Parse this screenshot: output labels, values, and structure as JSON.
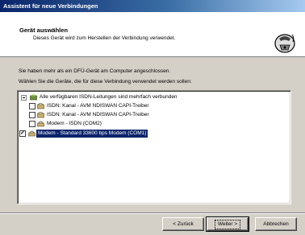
{
  "window": {
    "title": "Assistent für neue Verbindungen"
  },
  "header": {
    "title": "Gerät auswählen",
    "subtitle": "Dieses Gerät wird zum Herstellen der Verbindung verwendet.",
    "icon": "phone-connection-icon"
  },
  "instructions": {
    "line1": "Sie haben mehr als ein DFÜ-Gerät am Computer angeschlossen.",
    "line2": "Wählen Sie die Geräte, die für diese Verbindung verwendet werden sollen:"
  },
  "devices": [
    {
      "label": "Alle verfügbaren ISDN-Leitungen sind mehrfach verbunden",
      "checked": false,
      "tree": true,
      "icon": "isdn-icon"
    },
    {
      "label": "ISDN: Kanal - AVM NDISWAN CAPI-Treiber",
      "checked": false,
      "icon": "isdn-icon"
    },
    {
      "label": "ISDN: Kanal - AVM NDISWAN CAPI-Treiber",
      "checked": false,
      "icon": "isdn-icon"
    },
    {
      "label": "Modem - ISDN (COM2)",
      "checked": false,
      "icon": "modem-icon"
    },
    {
      "label": "Modem - Standard 33600 bps Modem (COM1)",
      "checked": true,
      "selected": true,
      "icon": "modem-icon"
    }
  ],
  "buttons": {
    "back": "< Zurück",
    "next": "Weiter >",
    "cancel": "Abbrechen"
  },
  "colors": {
    "title_bar": "#0a246a",
    "selection": "#0a246a",
    "face": "#d4d0c8"
  }
}
